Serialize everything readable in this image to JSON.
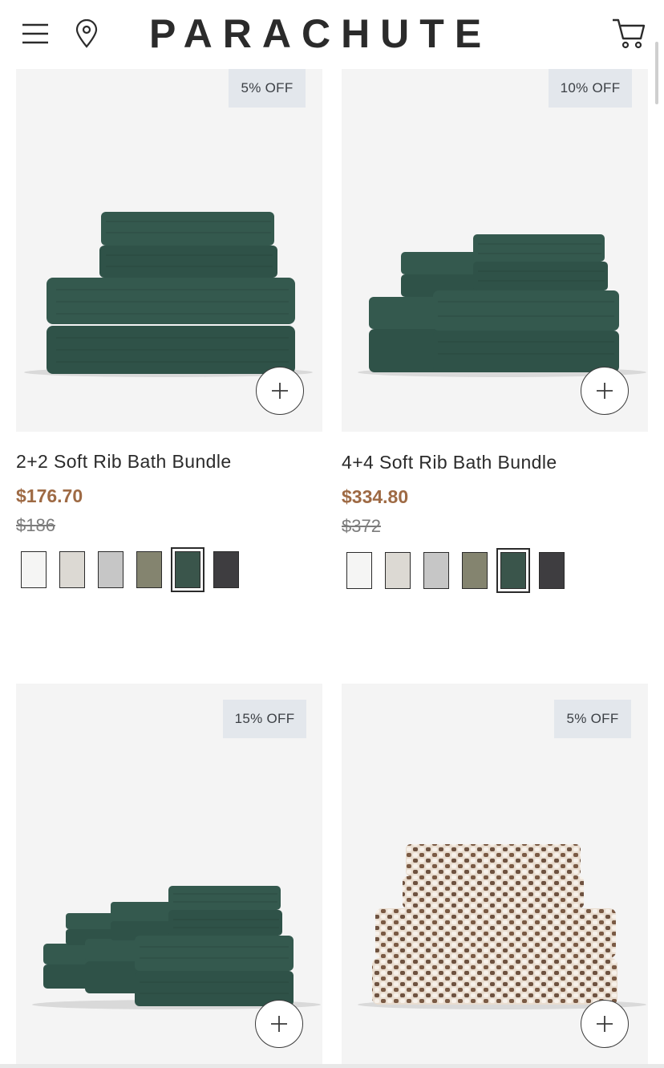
{
  "header": {
    "brand": "PARACHUTE",
    "icons": [
      "menu-icon",
      "location-pin-icon",
      "cart-icon"
    ]
  },
  "products": [
    {
      "badge": "5% OFF",
      "title": "2+2 Soft Rib Bath Bundle",
      "price": "$176.70",
      "compare_price": "$186",
      "swatches": [
        "#f5f5f4",
        "#dcd9d3",
        "#c6c6c6",
        "#84846f",
        "#3a554b",
        "#3e3d40"
      ],
      "selected_swatch": 4
    },
    {
      "badge": "10% OFF",
      "title": "4+4 Soft Rib Bath Bundle",
      "price": "$334.80",
      "compare_price": "$372",
      "swatches": [
        "#f5f5f4",
        "#dcd9d3",
        "#c6c6c6",
        "#84846f",
        "#3a554b",
        "#3e3d40"
      ],
      "selected_swatch": 4
    },
    {
      "badge": "15% OFF",
      "title": "",
      "price": "",
      "compare_price": ""
    },
    {
      "badge": "5% OFF",
      "title": "",
      "price": "",
      "compare_price": ""
    }
  ],
  "colors": {
    "price": "#9e6a44",
    "badge_bg": "#e3e7ec",
    "towel_green": "#2f5248",
    "image_bg": "#f4f4f4"
  }
}
